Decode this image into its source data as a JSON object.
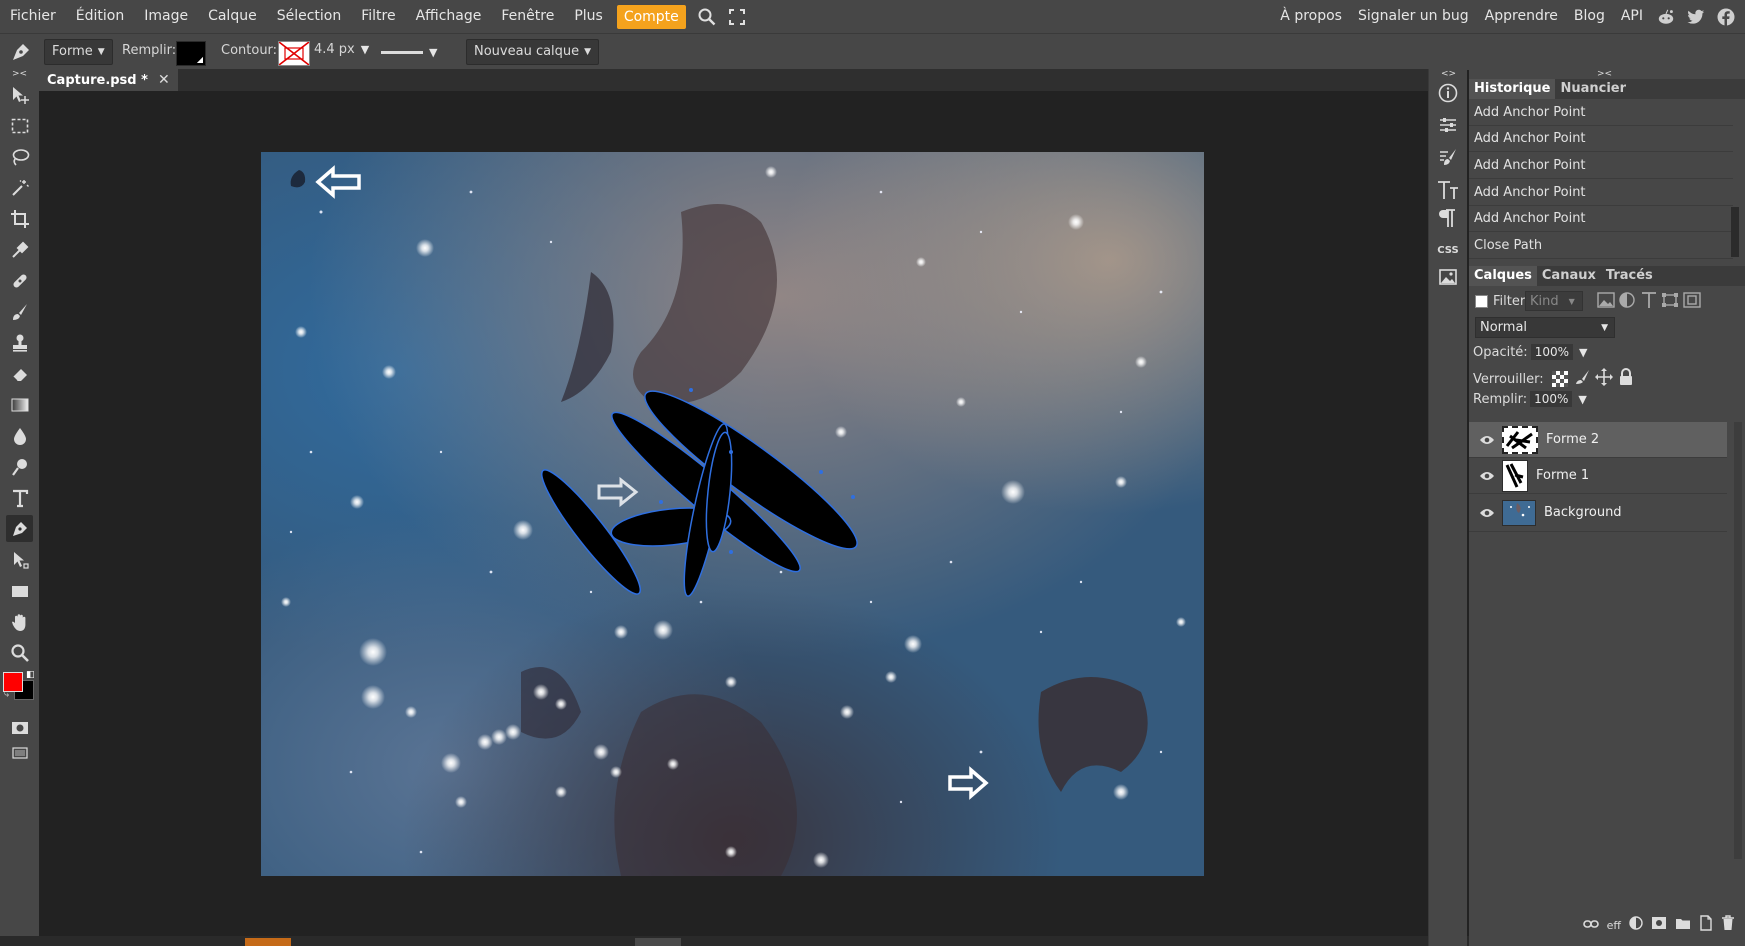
{
  "menubar": {
    "items": [
      "Fichier",
      "Édition",
      "Image",
      "Calque",
      "Sélection",
      "Filtre",
      "Affichage",
      "Fenêtre",
      "Plus"
    ],
    "compte": "Compte",
    "right_items": [
      "À propos",
      "Signaler un bug",
      "Apprendre",
      "Blog",
      "API"
    ],
    "icons": [
      "search-icon",
      "fullscreen-icon",
      "reddit-icon",
      "twitter-icon",
      "facebook-icon"
    ]
  },
  "options": {
    "shape_mode": "Forme",
    "fill_label": "Remplir:",
    "stroke_label": "Contour:",
    "stroke_width": "4.4 px",
    "new_layer": "Nouveau calque"
  },
  "colors": {
    "accent": "#f4a21d",
    "foreground_color": "#ff0000",
    "background_color": "#000000",
    "path_outline": "#2f6fe0"
  },
  "document": {
    "tab_title": "Capture.psd *"
  },
  "history": {
    "tabs": [
      "Historique",
      "Nuancier"
    ],
    "items": [
      "Add Anchor Point",
      "Add Anchor Point",
      "Add Anchor Point",
      "Add Anchor Point",
      "Add Anchor Point",
      "Close Path"
    ]
  },
  "layers_panel": {
    "tabs": [
      "Calques",
      "Canaux",
      "Tracés"
    ],
    "filter_label": "Filter",
    "kind_label": "Kind",
    "blend_mode": "Normal",
    "opacity_label": "Opacité:",
    "opacity_value": "100%",
    "lock_label": "Verrouiller:",
    "fill_label": "Remplir:",
    "fill_value": "100%",
    "layers": [
      {
        "name": "Forme 2",
        "selected": true
      },
      {
        "name": "Forme 1",
        "selected": false
      },
      {
        "name": "Background",
        "selected": false
      }
    ],
    "footer": {
      "effects_label": "eff"
    }
  },
  "side_icons": {
    "css_label": "CSS"
  }
}
